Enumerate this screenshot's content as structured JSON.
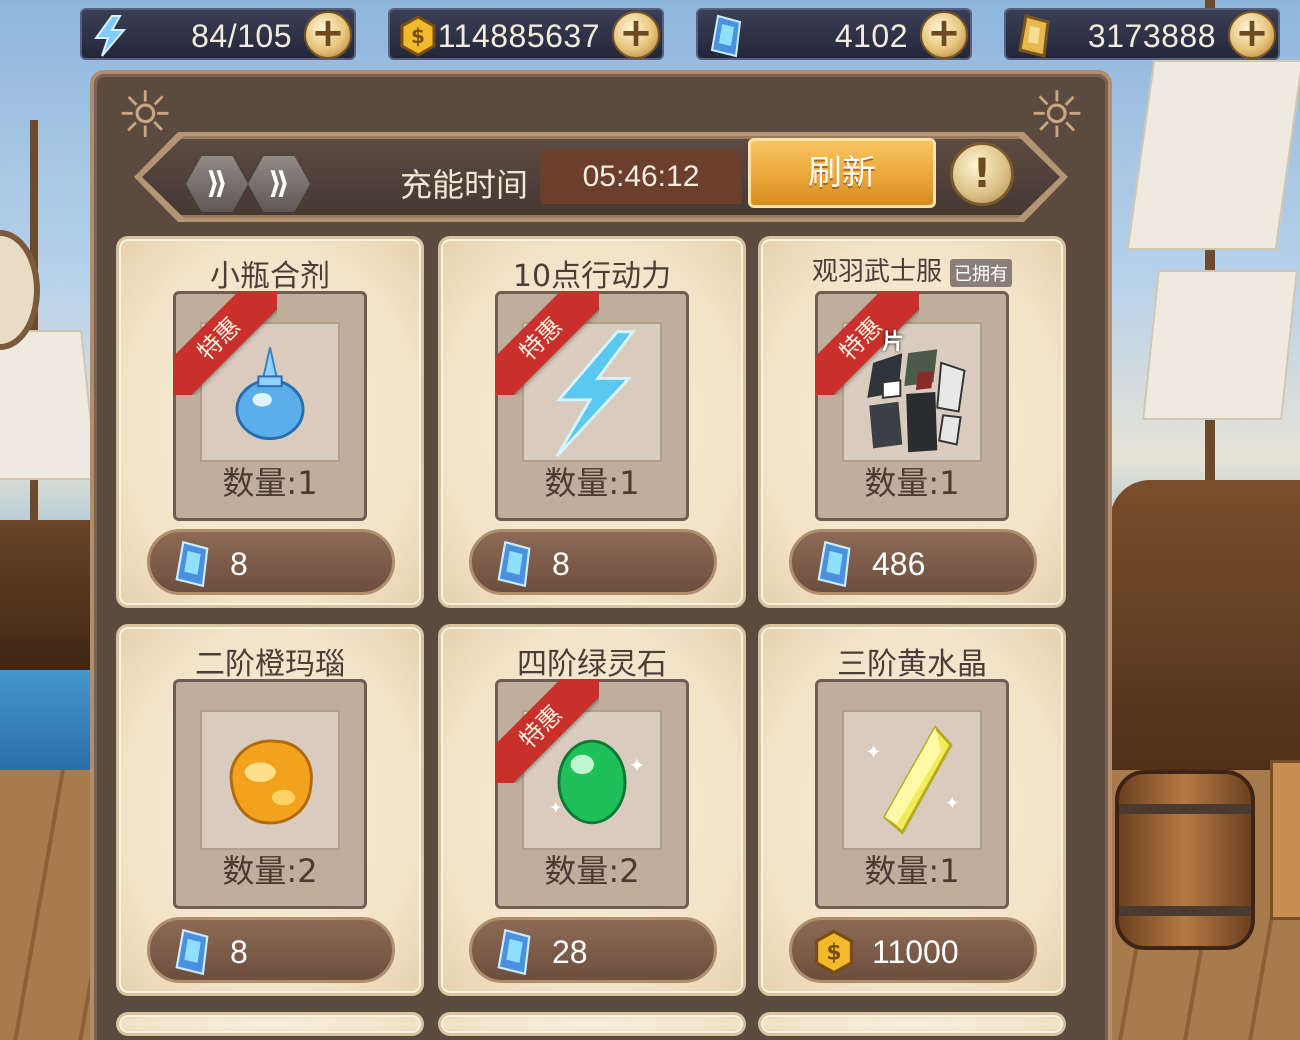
{
  "resources": {
    "energy": {
      "icon": "lightning-icon",
      "value": "84/105",
      "add": "+"
    },
    "gold": {
      "icon": "gold-coin-icon",
      "value": "114885637",
      "add": "+"
    },
    "gems": {
      "icon": "blue-crystal-icon",
      "value": "4102",
      "add": "+"
    },
    "tokens": {
      "icon": "gold-token-icon",
      "value": "3173888",
      "add": "+"
    }
  },
  "shop": {
    "emblem_glyph": "☼",
    "skip_icons": [
      "⟫",
      "⟫"
    ],
    "timer_label": "充能时间",
    "timer_value": "05:46:12",
    "refresh_label": "刷新",
    "info_label": "!"
  },
  "items": [
    {
      "name": "小瓶合剂",
      "badge": "特惠",
      "quantity": "数量:1",
      "price": "8",
      "currency": "blue-crystal-icon",
      "icon": "potion-bottle-icon"
    },
    {
      "name": "10点行动力",
      "badge": "特惠",
      "quantity": "数量:1",
      "price": "8",
      "currency": "blue-crystal-icon",
      "icon": "lightning-bolt-icon"
    },
    {
      "name": "观羽武士服",
      "owned_tag": "已拥有",
      "badge": "特惠",
      "fragment_label": "片",
      "quantity": "数量:1",
      "price": "486",
      "currency": "blue-crystal-icon",
      "icon": "costume-fragment-icon"
    },
    {
      "name": "二阶橙玛瑙",
      "quantity": "数量:2",
      "price": "8",
      "currency": "blue-crystal-icon",
      "icon": "orange-agate-icon"
    },
    {
      "name": "四阶绿灵石",
      "badge": "特惠",
      "quantity": "数量:2",
      "price": "28",
      "currency": "blue-crystal-icon",
      "icon": "green-gem-icon"
    },
    {
      "name": "三阶黄水晶",
      "quantity": "数量:1",
      "price": "11000",
      "currency": "gold-coin-icon",
      "icon": "yellow-crystal-icon"
    }
  ],
  "colors": {
    "accent_orange": "#e9a436",
    "badge_red": "#c9302b",
    "panel_brown": "#5b4a3f",
    "card_cream": "#f2e3c7"
  }
}
